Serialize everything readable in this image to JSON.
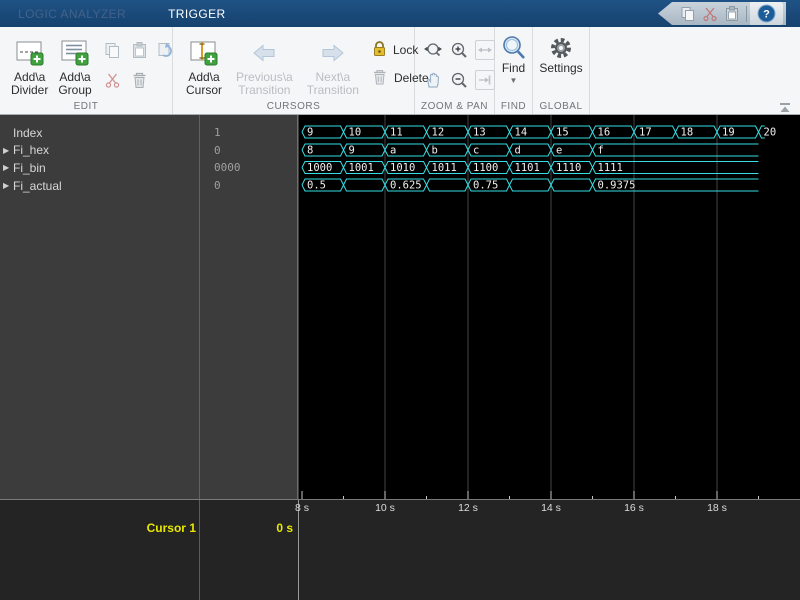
{
  "titlebar": {
    "tab_inactive": "LOGIC ANALYZER",
    "tab_active": "TRIGGER",
    "help": "?"
  },
  "ribbon": {
    "edit": {
      "label": "EDIT",
      "add_divider_l1": "Add\\a",
      "add_divider_l2": "Divider",
      "add_group_l1": "Add\\a",
      "add_group_l2": "Group"
    },
    "cursors": {
      "label": "CURSORS",
      "add_cursor_l1": "Add\\a",
      "add_cursor_l2": "Cursor",
      "prev_l1": "Previous\\a",
      "prev_l2": "Transition",
      "next_l1": "Next\\a",
      "next_l2": "Transition",
      "lock": "Lock",
      "del": "Delete"
    },
    "zoompan": {
      "label": "ZOOM & PAN"
    },
    "find": {
      "label": "FIND",
      "button": "Find"
    },
    "global": {
      "label": "GLOBAL",
      "button": "Settings"
    }
  },
  "icons": [
    "copy-icon",
    "cut-icon",
    "paste-icon",
    "help-icon",
    "add-divider-icon",
    "add-group-icon",
    "restore-icon",
    "delete-icon",
    "add-cursor-icon",
    "previous-transition-icon",
    "next-transition-icon",
    "lock-icon",
    "zoom-in-x-icon",
    "zoom-in-icon",
    "fit-to-view-icon",
    "pan-icon",
    "zoom-out-icon",
    "snap-right-icon",
    "find-icon",
    "settings-gear-icon",
    "collapse-ribbon-icon",
    "expand-triangle-icon"
  ],
  "signals": [
    {
      "arrow": "",
      "name": "Index",
      "value": "1"
    },
    {
      "arrow": "▶",
      "name": "Fi_hex",
      "value": "0"
    },
    {
      "arrow": "▶",
      "name": "Fi_bin",
      "value": "0000"
    },
    {
      "arrow": "▶",
      "name": "Fi_actual",
      "value": "0"
    }
  ],
  "cursor_panel": {
    "name": "Cursor 1",
    "value": "0 s"
  },
  "colors": {
    "trace": "#35dee6",
    "plot_bg": "#000000",
    "grid": "#454545",
    "tick": "#c9c9c9",
    "segment_label": "#f0f0f0",
    "cursor_text": "#e8e800",
    "titlebar": "#1a4a7a"
  },
  "chart_data": {
    "type": "digital-bus-waveform",
    "time_unit": "s",
    "time_window": [
      7.93,
      20.08
    ],
    "axis": {
      "majors": [
        {
          "t": 8,
          "label": "8 s"
        },
        {
          "t": 10,
          "label": "10 s"
        },
        {
          "t": 12,
          "label": "12 s"
        },
        {
          "t": 14,
          "label": "14 s"
        },
        {
          "t": 16,
          "label": "16 s"
        },
        {
          "t": 18,
          "label": "18 s"
        }
      ],
      "minors": [
        9,
        11,
        13,
        15,
        17,
        19
      ]
    },
    "gridlines": [
      10,
      12,
      14,
      16,
      18
    ],
    "series": [
      {
        "name": "Index",
        "segments": [
          {
            "t0": 8,
            "t1": 9,
            "label": "9"
          },
          {
            "t0": 9,
            "t1": 10,
            "label": "10"
          },
          {
            "t0": 10,
            "t1": 11,
            "label": "11"
          },
          {
            "t0": 11,
            "t1": 12,
            "label": "12"
          },
          {
            "t0": 12,
            "t1": 13,
            "label": "13"
          },
          {
            "t0": 13,
            "t1": 14,
            "label": "14"
          },
          {
            "t0": 14,
            "t1": 15,
            "label": "15"
          },
          {
            "t0": 15,
            "t1": 16,
            "label": "16"
          },
          {
            "t0": 16,
            "t1": 17,
            "label": "17"
          },
          {
            "t0": 17,
            "t1": 18,
            "label": "18"
          },
          {
            "t0": 18,
            "t1": 19,
            "label": "19"
          },
          {
            "t0": 19,
            "t1": 19.15,
            "label": "20",
            "end": "open"
          }
        ]
      },
      {
        "name": "Fi_hex",
        "segments": [
          {
            "t0": 8,
            "t1": 9,
            "label": "8"
          },
          {
            "t0": 9,
            "t1": 10,
            "label": "9"
          },
          {
            "t0": 10,
            "t1": 11,
            "label": "a"
          },
          {
            "t0": 11,
            "t1": 12,
            "label": "b"
          },
          {
            "t0": 12,
            "t1": 13,
            "label": "c"
          },
          {
            "t0": 13,
            "t1": 14,
            "label": "d"
          },
          {
            "t0": 14,
            "t1": 15,
            "label": "e"
          },
          {
            "t0": 15,
            "t1": 19,
            "label": "f",
            "end": "open"
          }
        ]
      },
      {
        "name": "Fi_bin",
        "segments": [
          {
            "t0": 8,
            "t1": 9,
            "label": "1000"
          },
          {
            "t0": 9,
            "t1": 10,
            "label": "1001"
          },
          {
            "t0": 10,
            "t1": 11,
            "label": "1010"
          },
          {
            "t0": 11,
            "t1": 12,
            "label": "1011"
          },
          {
            "t0": 12,
            "t1": 13,
            "label": "1100"
          },
          {
            "t0": 13,
            "t1": 14,
            "label": "1101"
          },
          {
            "t0": 14,
            "t1": 15,
            "label": "1110"
          },
          {
            "t0": 15,
            "t1": 19,
            "label": "1111",
            "end": "open"
          }
        ]
      },
      {
        "name": "Fi_actual",
        "segments": [
          {
            "t0": 8,
            "t1": 9,
            "label": "0.5"
          },
          {
            "t0": 9,
            "t1": 10,
            "label": ""
          },
          {
            "t0": 10,
            "t1": 11,
            "label": "0.625"
          },
          {
            "t0": 11,
            "t1": 12,
            "label": ""
          },
          {
            "t0": 12,
            "t1": 13,
            "label": "0.75"
          },
          {
            "t0": 13,
            "t1": 14,
            "label": ""
          },
          {
            "t0": 14,
            "t1": 15,
            "label": ""
          },
          {
            "t0": 15,
            "t1": 19,
            "label": "0.9375",
            "end": "open"
          }
        ]
      }
    ]
  }
}
